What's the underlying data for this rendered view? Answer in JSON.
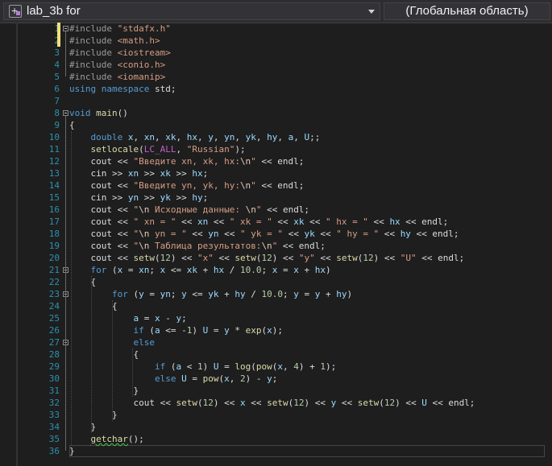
{
  "header": {
    "project_dropdown": {
      "label": "lab_3b for",
      "icon": "cpp-project-icon"
    },
    "scope_dropdown": {
      "label": "(Глобальная область)"
    }
  },
  "editor": {
    "current_line": 36,
    "lines": [
      [
        [
          "pp",
          "#include "
        ],
        [
          "hdr",
          "\"stdafx.h\""
        ]
      ],
      [
        [
          "pp",
          "#include "
        ],
        [
          "hdr",
          "<math.h>"
        ]
      ],
      [
        [
          "pp",
          "#include "
        ],
        [
          "hdr",
          "<iostream>"
        ]
      ],
      [
        [
          "pp",
          "#include "
        ],
        [
          "hdr",
          "<conio.h>"
        ]
      ],
      [
        [
          "pp",
          "#include "
        ],
        [
          "hdr",
          "<iomanip>"
        ]
      ],
      [
        [
          "kw",
          "using"
        ],
        [
          "pl",
          " "
        ],
        [
          "kw",
          "namespace"
        ],
        [
          "pl",
          " std;"
        ]
      ],
      [
        [
          "pl",
          ""
        ]
      ],
      [
        [
          "kw",
          "void"
        ],
        [
          "pl",
          " "
        ],
        [
          "fn",
          "main"
        ],
        [
          "pl",
          "()"
        ]
      ],
      [
        [
          "pl",
          "{"
        ]
      ],
      [
        [
          "pl",
          "    "
        ],
        [
          "kw",
          "double"
        ],
        [
          "pl",
          " "
        ],
        [
          "var",
          "x"
        ],
        [
          "pl",
          ", "
        ],
        [
          "var",
          "xn"
        ],
        [
          "pl",
          ", "
        ],
        [
          "var",
          "xk"
        ],
        [
          "pl",
          ", "
        ],
        [
          "var",
          "hx"
        ],
        [
          "pl",
          ", "
        ],
        [
          "var",
          "y"
        ],
        [
          "pl",
          ", "
        ],
        [
          "var",
          "yn"
        ],
        [
          "pl",
          ", "
        ],
        [
          "var",
          "yk"
        ],
        [
          "pl",
          ", "
        ],
        [
          "var",
          "hy"
        ],
        [
          "pl",
          ", "
        ],
        [
          "var",
          "a"
        ],
        [
          "pl",
          ", "
        ],
        [
          "var",
          "U"
        ],
        [
          "pl",
          ";;"
        ]
      ],
      [
        [
          "pl",
          "    "
        ],
        [
          "fn",
          "setlocale"
        ],
        [
          "pl",
          "("
        ],
        [
          "mac",
          "LC_ALL"
        ],
        [
          "pl",
          ", "
        ],
        [
          "str",
          "\"Russian\""
        ],
        [
          "pl",
          ");"
        ]
      ],
      [
        [
          "pl",
          "    cout << "
        ],
        [
          "str",
          "\"Введите xn, xk, hx:"
        ],
        [
          "esc",
          "\\n"
        ],
        [
          "str",
          "\""
        ],
        [
          "pl",
          " << endl;"
        ]
      ],
      [
        [
          "pl",
          "    cin >> "
        ],
        [
          "var",
          "xn"
        ],
        [
          "pl",
          " >> "
        ],
        [
          "var",
          "xk"
        ],
        [
          "pl",
          " >> "
        ],
        [
          "var",
          "hx"
        ],
        [
          "pl",
          ";"
        ]
      ],
      [
        [
          "pl",
          "    cout << "
        ],
        [
          "str",
          "\"Введите yn, yk, hy:"
        ],
        [
          "esc",
          "\\n"
        ],
        [
          "str",
          "\""
        ],
        [
          "pl",
          " << endl;"
        ]
      ],
      [
        [
          "pl",
          "    cin >> "
        ],
        [
          "var",
          "yn"
        ],
        [
          "pl",
          " >> "
        ],
        [
          "var",
          "yk"
        ],
        [
          "pl",
          " >> "
        ],
        [
          "var",
          "hy"
        ],
        [
          "pl",
          ";"
        ]
      ],
      [
        [
          "pl",
          "    cout << "
        ],
        [
          "str",
          "\""
        ],
        [
          "esc",
          "\\n"
        ],
        [
          "str",
          " Исходные данные: "
        ],
        [
          "esc",
          "\\n"
        ],
        [
          "str",
          "\""
        ],
        [
          "pl",
          " << endl;"
        ]
      ],
      [
        [
          "pl",
          "    cout << "
        ],
        [
          "str",
          "\" xn = \""
        ],
        [
          "pl",
          " << "
        ],
        [
          "var",
          "xn"
        ],
        [
          "pl",
          " << "
        ],
        [
          "str",
          "\" xk = \""
        ],
        [
          "pl",
          " << "
        ],
        [
          "var",
          "xk"
        ],
        [
          "pl",
          " << "
        ],
        [
          "str",
          "\" hx = \""
        ],
        [
          "pl",
          " << "
        ],
        [
          "var",
          "hx"
        ],
        [
          "pl",
          " << endl;"
        ]
      ],
      [
        [
          "pl",
          "    cout << "
        ],
        [
          "str",
          "\""
        ],
        [
          "esc",
          "\\n"
        ],
        [
          "str",
          " yn = \""
        ],
        [
          "pl",
          " << "
        ],
        [
          "var",
          "yn"
        ],
        [
          "pl",
          " << "
        ],
        [
          "str",
          "\" yk = \""
        ],
        [
          "pl",
          " << "
        ],
        [
          "var",
          "yk"
        ],
        [
          "pl",
          " << "
        ],
        [
          "str",
          "\" hy = \""
        ],
        [
          "pl",
          " << "
        ],
        [
          "var",
          "hy"
        ],
        [
          "pl",
          " << endl;"
        ]
      ],
      [
        [
          "pl",
          "    cout << "
        ],
        [
          "str",
          "\""
        ],
        [
          "esc",
          "\\n"
        ],
        [
          "str",
          " Таблица результатов:"
        ],
        [
          "esc",
          "\\n"
        ],
        [
          "str",
          "\""
        ],
        [
          "pl",
          " << endl;"
        ]
      ],
      [
        [
          "pl",
          "    cout << "
        ],
        [
          "fn",
          "setw"
        ],
        [
          "pl",
          "("
        ],
        [
          "num",
          "12"
        ],
        [
          "pl",
          ") << "
        ],
        [
          "str",
          "\"x\""
        ],
        [
          "pl",
          " << "
        ],
        [
          "fn",
          "setw"
        ],
        [
          "pl",
          "("
        ],
        [
          "num",
          "12"
        ],
        [
          "pl",
          ") << "
        ],
        [
          "str",
          "\"y\""
        ],
        [
          "pl",
          " << "
        ],
        [
          "fn",
          "setw"
        ],
        [
          "pl",
          "("
        ],
        [
          "num",
          "12"
        ],
        [
          "pl",
          ") << "
        ],
        [
          "str",
          "\"U\""
        ],
        [
          "pl",
          " << endl;"
        ]
      ],
      [
        [
          "pl",
          "    "
        ],
        [
          "kw",
          "for"
        ],
        [
          "pl",
          " ("
        ],
        [
          "var",
          "x"
        ],
        [
          "pl",
          " = "
        ],
        [
          "var",
          "xn"
        ],
        [
          "pl",
          "; "
        ],
        [
          "var",
          "x"
        ],
        [
          "pl",
          " <= "
        ],
        [
          "var",
          "xk"
        ],
        [
          "pl",
          " + "
        ],
        [
          "var",
          "hx"
        ],
        [
          "pl",
          " / "
        ],
        [
          "num",
          "10.0"
        ],
        [
          "pl",
          "; "
        ],
        [
          "var",
          "x"
        ],
        [
          "pl",
          " = "
        ],
        [
          "var",
          "x"
        ],
        [
          "pl",
          " + "
        ],
        [
          "var",
          "hx"
        ],
        [
          "pl",
          ")"
        ]
      ],
      [
        [
          "pl",
          "    {"
        ]
      ],
      [
        [
          "pl",
          "        "
        ],
        [
          "kw",
          "for"
        ],
        [
          "pl",
          " ("
        ],
        [
          "var",
          "y"
        ],
        [
          "pl",
          " = "
        ],
        [
          "var",
          "yn"
        ],
        [
          "pl",
          "; "
        ],
        [
          "var",
          "y"
        ],
        [
          "pl",
          " <= "
        ],
        [
          "var",
          "yk"
        ],
        [
          "pl",
          " + "
        ],
        [
          "var",
          "hy"
        ],
        [
          "pl",
          " / "
        ],
        [
          "num",
          "10.0"
        ],
        [
          "pl",
          "; "
        ],
        [
          "var",
          "y"
        ],
        [
          "pl",
          " = "
        ],
        [
          "var",
          "y"
        ],
        [
          "pl",
          " + "
        ],
        [
          "var",
          "hy"
        ],
        [
          "pl",
          ")"
        ]
      ],
      [
        [
          "pl",
          "        {"
        ]
      ],
      [
        [
          "pl",
          "            "
        ],
        [
          "var",
          "a"
        ],
        [
          "pl",
          " = "
        ],
        [
          "var",
          "x"
        ],
        [
          "pl",
          " - "
        ],
        [
          "var",
          "y"
        ],
        [
          "pl",
          ";"
        ]
      ],
      [
        [
          "pl",
          "            "
        ],
        [
          "kw",
          "if"
        ],
        [
          "pl",
          " ("
        ],
        [
          "var",
          "a"
        ],
        [
          "pl",
          " <= -"
        ],
        [
          "num",
          "1"
        ],
        [
          "pl",
          ") "
        ],
        [
          "var",
          "U"
        ],
        [
          "pl",
          " = "
        ],
        [
          "var",
          "y"
        ],
        [
          "pl",
          " * "
        ],
        [
          "fn",
          "exp"
        ],
        [
          "pl",
          "("
        ],
        [
          "var",
          "x"
        ],
        [
          "pl",
          ");"
        ]
      ],
      [
        [
          "pl",
          "            "
        ],
        [
          "kw",
          "else"
        ]
      ],
      [
        [
          "pl",
          "            {"
        ]
      ],
      [
        [
          "pl",
          "                "
        ],
        [
          "kw",
          "if"
        ],
        [
          "pl",
          " ("
        ],
        [
          "var",
          "a"
        ],
        [
          "pl",
          " < "
        ],
        [
          "num",
          "1"
        ],
        [
          "pl",
          ") "
        ],
        [
          "var",
          "U"
        ],
        [
          "pl",
          " = "
        ],
        [
          "fn",
          "log"
        ],
        [
          "pl",
          "("
        ],
        [
          "fn",
          "pow"
        ],
        [
          "pl",
          "("
        ],
        [
          "var",
          "x"
        ],
        [
          "pl",
          ", "
        ],
        [
          "num",
          "4"
        ],
        [
          "pl",
          ") + "
        ],
        [
          "num",
          "1"
        ],
        [
          "pl",
          ");"
        ]
      ],
      [
        [
          "pl",
          "                "
        ],
        [
          "kw",
          "else"
        ],
        [
          "pl",
          " "
        ],
        [
          "var",
          "U"
        ],
        [
          "pl",
          " = "
        ],
        [
          "fn",
          "pow"
        ],
        [
          "pl",
          "("
        ],
        [
          "var",
          "x"
        ],
        [
          "pl",
          ", "
        ],
        [
          "num",
          "2"
        ],
        [
          "pl",
          ") - "
        ],
        [
          "var",
          "y"
        ],
        [
          "pl",
          ";"
        ]
      ],
      [
        [
          "pl",
          "            }"
        ]
      ],
      [
        [
          "pl",
          "            cout << "
        ],
        [
          "fn",
          "setw"
        ],
        [
          "pl",
          "("
        ],
        [
          "num",
          "12"
        ],
        [
          "pl",
          ") << "
        ],
        [
          "var",
          "x"
        ],
        [
          "pl",
          " << "
        ],
        [
          "fn",
          "setw"
        ],
        [
          "pl",
          "("
        ],
        [
          "num",
          "12"
        ],
        [
          "pl",
          ") << "
        ],
        [
          "var",
          "y"
        ],
        [
          "pl",
          " << "
        ],
        [
          "fn",
          "setw"
        ],
        [
          "pl",
          "("
        ],
        [
          "num",
          "12"
        ],
        [
          "pl",
          ") << "
        ],
        [
          "var",
          "U"
        ],
        [
          "pl",
          " << endl;"
        ]
      ],
      [
        [
          "pl",
          "        }"
        ]
      ],
      [
        [
          "pl",
          "    }"
        ]
      ],
      [
        [
          "pl",
          "    "
        ],
        [
          "fn",
          "getchar"
        ],
        [
          "pl",
          "();"
        ]
      ],
      [
        [
          "pl",
          "}"
        ]
      ]
    ]
  }
}
